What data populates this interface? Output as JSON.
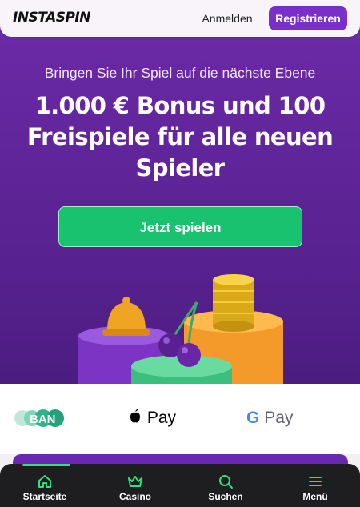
{
  "header": {
    "logo": "INSTASPIN",
    "login_label": "Anmelden",
    "register_label": "Registrieren"
  },
  "hero": {
    "subtitle": "Bringen Sie Ihr Spiel auf die nächste Ebene",
    "title": "1.000 € Bonus und 100 Freispiele für alle neuen Spieler",
    "cta_label": "Jetzt spielen"
  },
  "payments": {
    "ban": "BAN",
    "apple": "Pay",
    "google": "Pay"
  },
  "nav": {
    "items": [
      {
        "label": "Startseite",
        "icon": "home-icon"
      },
      {
        "label": "Casino",
        "icon": "crown-icon"
      },
      {
        "label": "Suchen",
        "icon": "search-icon"
      },
      {
        "label": "Menü",
        "icon": "menu-icon"
      }
    ]
  },
  "colors": {
    "brand_purple": "#7a2fc8",
    "hero_purple": "#5f2499",
    "cta_green": "#18c26e",
    "nav_active": "#2ee07f",
    "nav_bg": "#1e1d1f"
  }
}
